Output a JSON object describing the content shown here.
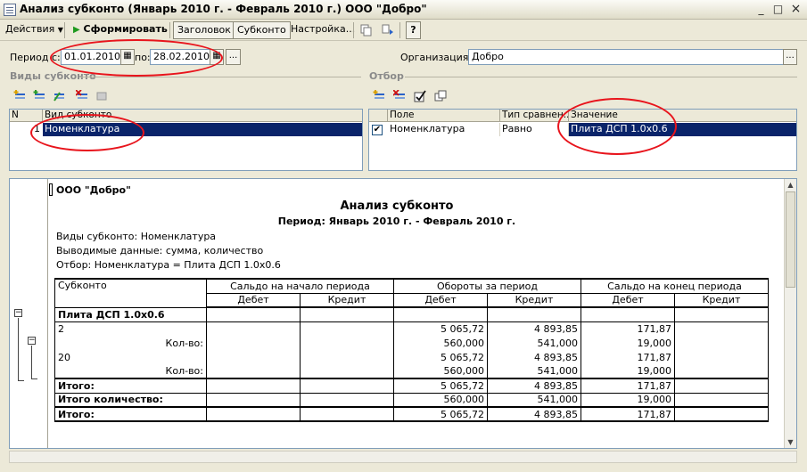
{
  "window": {
    "title": "Анализ субконто (Январь 2010 г. - Февраль 2010 г.) ООО \"Добро\"",
    "minimize": "_",
    "maximize": "□",
    "close": "×"
  },
  "toolbar": {
    "actions_label": "Действия",
    "generate_label": "Сформировать",
    "header_label": "Заголовок",
    "subconto_label": "Субконто",
    "settings_label": "Настройка...",
    "help_label": "?"
  },
  "period": {
    "label_from": "Период с:",
    "from_value": "01.01.2010",
    "label_to": "по:",
    "to_value": "28.02.2010",
    "more_label": "..."
  },
  "organization": {
    "label": "Организация:",
    "value": "Добро",
    "more_label": "..."
  },
  "subconto_section": {
    "title": "Виды субконто",
    "columns": [
      "N",
      "Вид субконто"
    ],
    "rows": [
      {
        "n": "1",
        "name": "Номенклатура"
      }
    ]
  },
  "filter_section": {
    "title": "Отбор",
    "columns": [
      "",
      "Поле",
      "Тип сравнен...",
      "Значение"
    ],
    "rows": [
      {
        "checked": true,
        "field": "Номенклатура",
        "compare": "Равно",
        "value": "Плита ДСП 1.0x0.6"
      }
    ]
  },
  "report": {
    "company": "ООО \"Добро\"",
    "title": "Анализ субконто",
    "period": "Период: Январь 2010 г. - Февраль 2010 г.",
    "info": [
      "Виды субконто: Номенклатура",
      "Выводимые данные: сумма, количество",
      "Отбор: Номенклатура = Плита ДСП 1.0x0.6"
    ],
    "headers": {
      "subconto": "Субконто",
      "saldo_start": "Сальдо на начало периода",
      "turnover": "Обороты за период",
      "saldo_end": "Сальдо на конец периода",
      "debit": "Дебет",
      "credit": "Кредит"
    },
    "group": "Плита ДСП 1.0x0.6",
    "rows": [
      {
        "label": "2",
        "qty": false,
        "d1": "",
        "c1": "",
        "d2": "5 065,72",
        "c2": "4 893,85",
        "d3": "171,87",
        "c3": ""
      },
      {
        "label": "Кол-во:",
        "qty": true,
        "d1": "",
        "c1": "",
        "d2": "560,000",
        "c2": "541,000",
        "d3": "19,000",
        "c3": ""
      },
      {
        "label": "20",
        "qty": false,
        "d1": "",
        "c1": "",
        "d2": "5 065,72",
        "c2": "4 893,85",
        "d3": "171,87",
        "c3": ""
      },
      {
        "label": "Кол-во:",
        "qty": true,
        "d1": "",
        "c1": "",
        "d2": "560,000",
        "c2": "541,000",
        "d3": "19,000",
        "c3": ""
      }
    ],
    "totals": [
      {
        "label": "Итого:",
        "d2": "5 065,72",
        "c2": "4 893,85",
        "d3": "171,87"
      },
      {
        "label": "Итого количество:",
        "d2": "560,000",
        "c2": "541,000",
        "d3": "19,000"
      }
    ],
    "grand_total": {
      "label": "Итого:",
      "d2": "5 065,72",
      "c2": "4 893,85",
      "d3": "171,87"
    }
  },
  "colors": {
    "selection": "#0a246a",
    "annotation": "#e8141c",
    "generate_arrow": "#1f9a1f"
  }
}
